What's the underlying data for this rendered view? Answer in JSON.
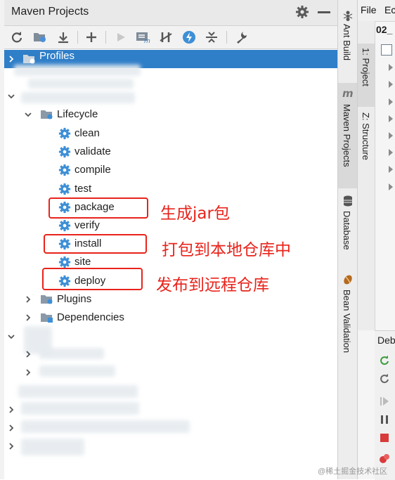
{
  "window": {
    "panel_title": "Maven Projects"
  },
  "toolbar": {
    "icons": [
      "refresh-icon",
      "generate-sources-icon",
      "download-icon",
      "add-icon",
      "run-icon",
      "execute-goal-icon",
      "toggle-offline-icon",
      "skip-tests-icon",
      "collapse-all-icon",
      "settings-wrench-icon"
    ]
  },
  "tree": {
    "profiles": "Profiles",
    "lifecycle": "Lifecycle",
    "goals": [
      "clean",
      "validate",
      "compile",
      "test",
      "package",
      "verify",
      "install",
      "site",
      "deploy"
    ],
    "plugins": "Plugins",
    "dependencies": "Dependencies"
  },
  "annotations": {
    "package": "生成jar包",
    "install": "打包到本地仓库中",
    "deploy": "发布到远程仓库"
  },
  "tool_tabs": {
    "ant_build": "Ant Build",
    "maven_projects": "Maven Projects",
    "database": "Database",
    "bean_validation": "Bean Validation",
    "project": "1: Project",
    "structure": "Z: Structure"
  },
  "menu": {
    "file": "File",
    "edit": "Ec"
  },
  "project": {
    "root": "02_"
  },
  "debug": {
    "title": "Deb"
  },
  "watermark": "@稀土掘金技术社区",
  "colors": {
    "selection": "#2f7ec8",
    "annotation": "#e8231b",
    "gear": "#3d8fd6"
  }
}
